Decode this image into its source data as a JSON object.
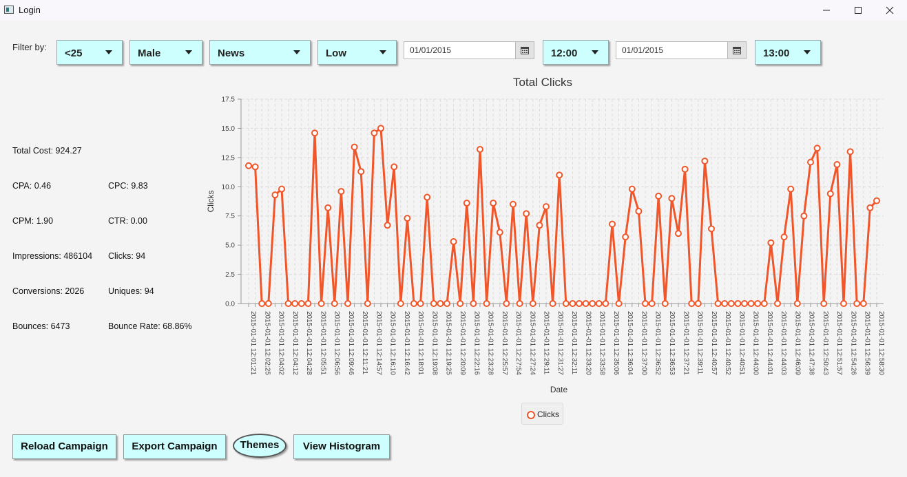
{
  "window": {
    "title": "Login"
  },
  "filter": {
    "label": "Filter by:",
    "age": "<25",
    "gender": "Male",
    "context": "News",
    "income": "Low",
    "start_date": "01/01/2015",
    "start_time": "12:00",
    "end_date": "01/01/2015",
    "end_time": "13:00"
  },
  "metrics": {
    "total_cost": "Total Cost: 924.27",
    "cpa": "CPA: 0.46",
    "cpc": "CPC: 9.83",
    "cpm": "CPM: 1.90",
    "ctr": "CTR: 0.00",
    "impressions": "Impressions: 486104",
    "clicks": "Clicks: 94",
    "conversions": "Conversions: 2026",
    "uniques": "Uniques: 94",
    "bounces": "Bounces: 6473",
    "bounce_rate": "Bounce Rate: 68.86%"
  },
  "buttons": {
    "reload": "Reload Campaign",
    "export": "Export Campaign",
    "themes": "Themes",
    "histogram": "View Histogram"
  },
  "colors": {
    "accent": "#ccfffe",
    "series": "#f0562a"
  },
  "chart_data": {
    "type": "line",
    "title": "Total Clicks",
    "xlabel": "Date",
    "ylabel": "Clicks",
    "ylim": [
      0,
      17.5
    ],
    "yticks": [
      "0.0",
      "2.5",
      "5.0",
      "7.5",
      "10.0",
      "12.5",
      "15.0",
      "17.5"
    ],
    "grid": true,
    "legend": "bottom-center",
    "tick_labels": [
      "2015-01-01 12:01:21",
      "2015-01-01 12:02:25",
      "2015-01-01 12:04:02",
      "2015-01-01 12:04:12",
      "2015-01-01 12:04:28",
      "2015-01-01 12:05:51",
      "2015-01-01 12:06:56",
      "2015-01-01 12:09:46",
      "2015-01-01 12:11:21",
      "2015-01-01 12:14:57",
      "2015-01-01 12:16:10",
      "2015-01-01 12:16:42",
      "2015-01-01 12:18:01",
      "2015-01-01 12:19:08",
      "2015-01-01 12:19:25",
      "2015-01-01 12:20:09",
      "2015-01-01 12:22:16",
      "2015-01-01 12:23:28",
      "2015-01-01 12:25:57",
      "2015-01-01 12:27:54",
      "2015-01-01 12:27:24",
      "2015-01-01 12:29:11",
      "2015-01-01 12:31:27",
      "2015-01-01 12:32:11",
      "2015-01-01 12:33:20",
      "2015-01-01 12:33:58",
      "2015-01-01 12:35:06",
      "2015-01-01 12:36:04",
      "2015-01-01 12:37:00",
      "2015-01-01 12:36:52",
      "2015-01-01 12:36:53",
      "2015-01-01 12:37:21",
      "2015-01-01 12:39:11",
      "2015-01-01 12:40:57",
      "2015-01-01 12:40:52",
      "2015-01-01 12:40:51",
      "2015-01-01 12:44:00",
      "2015-01-01 12:44:01",
      "2015-01-01 12:44:03",
      "2015-01-01 12:46:09",
      "2015-01-01 12:47:38",
      "2015-01-01 12:50:43",
      "2015-01-01 12:51:57",
      "2015-01-01 12:54:26",
      "2015-01-01 12:56:39",
      "2015-01-01 12:58:30"
    ],
    "series": [
      {
        "name": "Clicks",
        "values": [
          11.8,
          11.7,
          0,
          0,
          9.3,
          9.8,
          0,
          0,
          0,
          0,
          14.6,
          0,
          8.2,
          0,
          9.6,
          0,
          13.4,
          11.3,
          0,
          14.6,
          15.0,
          6.7,
          11.7,
          0,
          7.3,
          0,
          0,
          9.1,
          0,
          0,
          0,
          5.3,
          0,
          8.6,
          0,
          13.2,
          0,
          8.6,
          6.1,
          0,
          8.5,
          0,
          7.7,
          0,
          6.7,
          8.3,
          0,
          11.0,
          0,
          0,
          0,
          0,
          0,
          0,
          0,
          6.8,
          0,
          5.7,
          9.8,
          7.9,
          0,
          0,
          9.2,
          0,
          9.0,
          6.0,
          11.5,
          0,
          0,
          12.2,
          6.4,
          0,
          0,
          0,
          0,
          0,
          0,
          0,
          0,
          5.2,
          0,
          5.7,
          9.8,
          0,
          7.5,
          12.1,
          13.3,
          0,
          9.4,
          11.9,
          0,
          13.0,
          0,
          0,
          8.2,
          8.8
        ]
      }
    ]
  }
}
